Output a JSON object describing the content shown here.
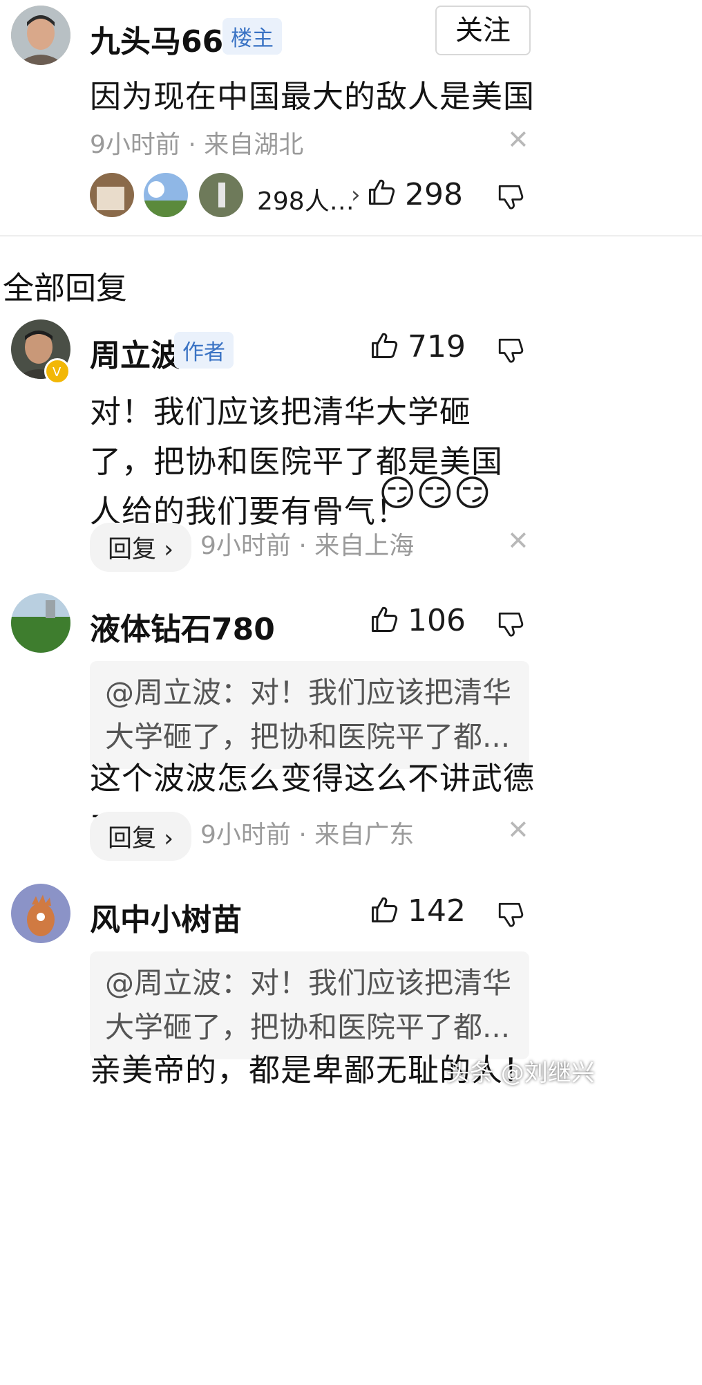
{
  "post": {
    "author": "九头马668",
    "badge": "楼主",
    "follow_label": "关注",
    "text": "因为现在中国最大的敌人是美国",
    "meta": "9小时前 · 来自湖北",
    "likers_text": "298人…",
    "like_count": "298"
  },
  "section_title": "全部回复",
  "replies": [
    {
      "author": "周立波",
      "badge": "作者",
      "like_count": "719",
      "text": "对！我们应该把清华大学砸了，把协和医院平了都是美国人给的我们要有骨气！",
      "reply_label": "回复",
      "meta": "9小时前 · 来自上海"
    },
    {
      "author": "液体钻石780",
      "like_count": "106",
      "quote": "@周立波：对！我们应该把清华大学砸了，把协和医院平了都...",
      "text": "这个波波怎么变得这么不讲武德了",
      "reply_label": "回复",
      "meta": "9小时前 · 来自广东"
    },
    {
      "author": "风中小树苗",
      "like_count": "142",
      "quote": "@周立波：对！我们应该把清华大学砸了，把协和医院平了都...",
      "text": "亲美帝的，都是卑鄙无耻的人！"
    }
  ],
  "watermark": "头条 @刘继兴",
  "colors": {
    "badge_blue": "#3a73c4",
    "muted": "#9a9a9a",
    "quote_bg": "#f5f5f5"
  },
  "icons": [
    "thumbs-up-icon",
    "thumbs-down-icon",
    "close-icon",
    "chevron-right-icon",
    "verified-icon",
    "emoji-icon"
  ]
}
